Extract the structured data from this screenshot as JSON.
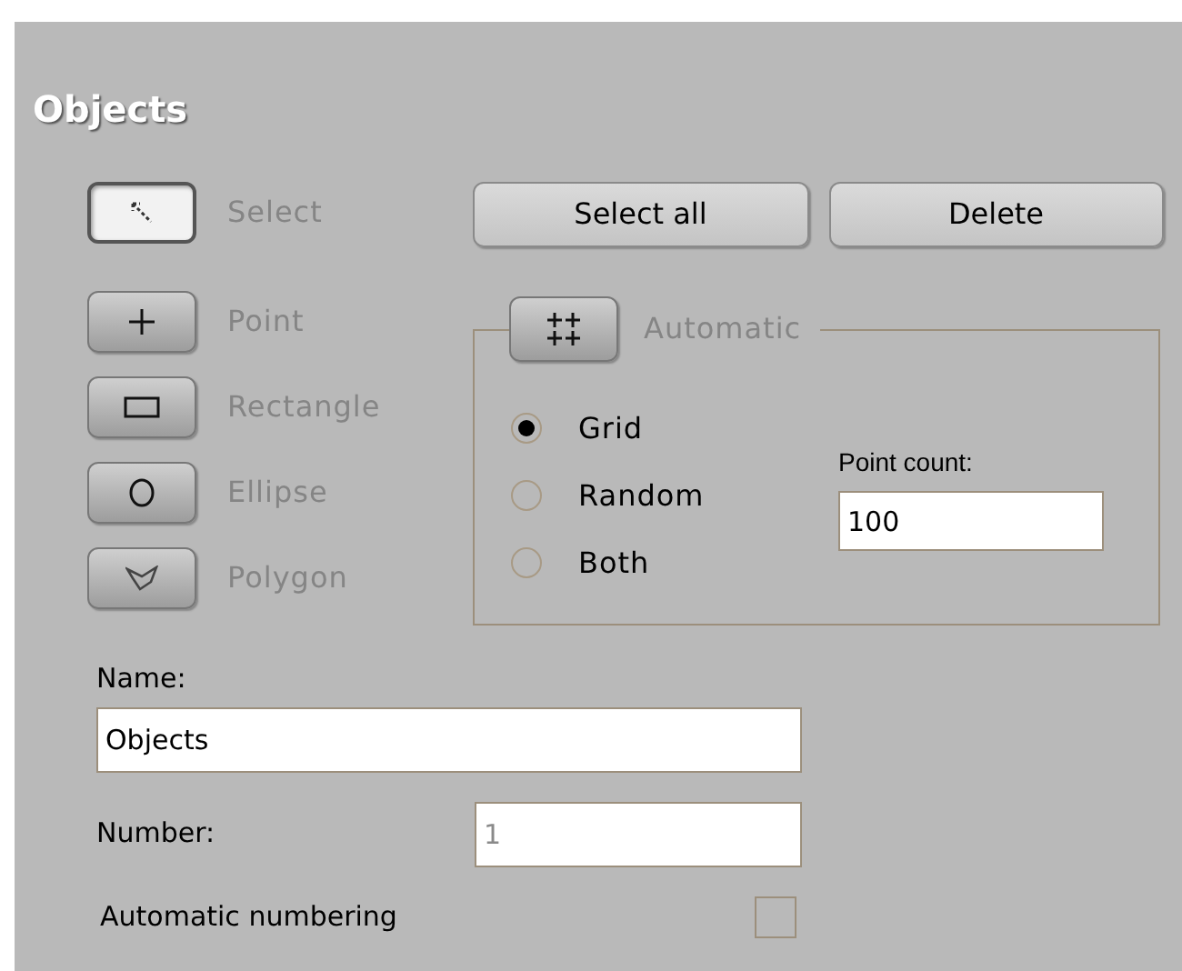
{
  "title": "Objects",
  "tools": [
    {
      "label": "Select",
      "kind": "arrow",
      "selected": true
    },
    {
      "label": "Point",
      "kind": "plus",
      "selected": false
    },
    {
      "label": "Rectangle",
      "kind": "rectangle",
      "selected": false
    },
    {
      "label": "Ellipse",
      "kind": "ellipse",
      "selected": false
    },
    {
      "label": "Polygon",
      "kind": "polygon",
      "selected": false
    }
  ],
  "actions": [
    "Select all",
    "Delete"
  ],
  "automatic": {
    "label": "Automatic",
    "options": [
      {
        "label": "Grid",
        "selected": true
      },
      {
        "label": "Random",
        "selected": false
      },
      {
        "label": "Both",
        "selected": false
      }
    ],
    "point_count": {
      "label": "Point count:",
      "value": "100"
    }
  },
  "name": {
    "label": "Name:",
    "value": "Objects"
  },
  "number": {
    "label": "Number:",
    "value": "1",
    "disabled": true
  },
  "auto_numbering": {
    "label": "Automatic numbering",
    "checked": false
  }
}
